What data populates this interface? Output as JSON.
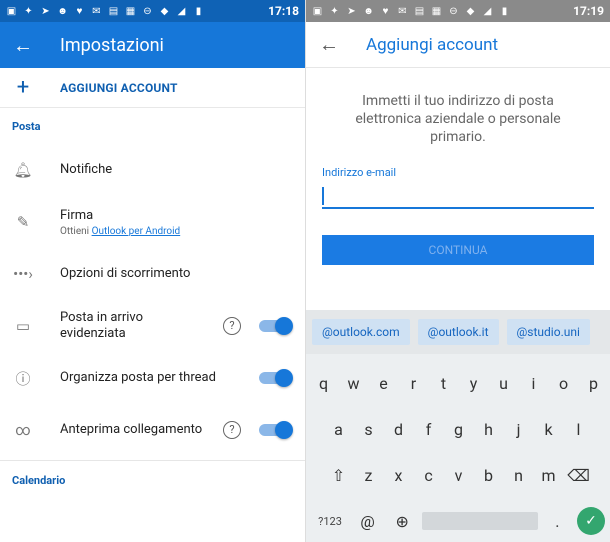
{
  "left": {
    "status_time": "17:18",
    "title": "Impostazioni",
    "add_account": "AGGIUNGI ACCOUNT",
    "section_mail": "Posta",
    "settings": [
      {
        "label": "Notifiche"
      },
      {
        "label": "Firma",
        "sub_prefix": "Ottieni ",
        "sub_link": "Outlook per Android"
      },
      {
        "label": "Opzioni di scorrimento"
      },
      {
        "label": "Posta in arrivo evidenziata"
      },
      {
        "label": "Organizza posta per thread"
      },
      {
        "label": "Anteprima collegamento"
      }
    ],
    "section_calendar": "Calendario"
  },
  "right": {
    "status_time": "17:19",
    "title": "Aggiungi account",
    "intro": "Immetti il tuo indirizzo di posta elettronica aziendale o personale primario.",
    "email_label": "Indirizzo e-mail",
    "continue": "CONTINUA",
    "chips": [
      "@outlook.com",
      "@outlook.it",
      "@studio.uni"
    ],
    "keyboard": {
      "row1": [
        "q",
        "w",
        "e",
        "r",
        "t",
        "y",
        "u",
        "i",
        "o",
        "p"
      ],
      "row2": [
        "a",
        "s",
        "d",
        "f",
        "g",
        "h",
        "j",
        "k",
        "l"
      ],
      "row3": [
        "z",
        "x",
        "c",
        "v",
        "b",
        "n",
        "m"
      ],
      "numeric_key": "?123",
      "at_key": "@",
      "dot_key": "."
    }
  },
  "colors": {
    "brand_blue": "#1677d9",
    "dark_blue": "#0f62b5",
    "enter_green": "#33a66f"
  }
}
